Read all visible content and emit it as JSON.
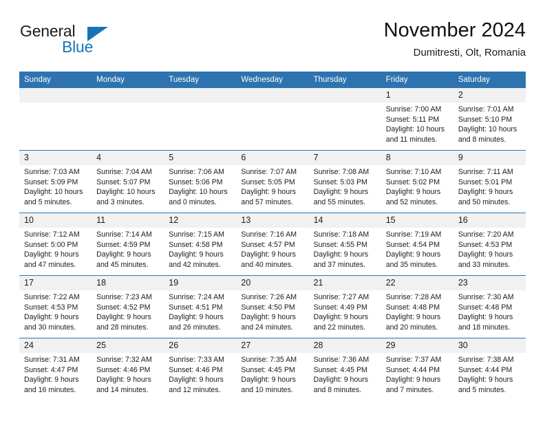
{
  "brand": {
    "name_part1": "General",
    "name_part2": "Blue"
  },
  "header": {
    "title": "November 2024",
    "subtitle": "Dumitresti, Olt, Romania"
  },
  "colors": {
    "header_blue": "#2e73b0",
    "brand_blue": "#1773b8",
    "daynum_bg": "#f1f1f1",
    "text": "#1b1b1b"
  },
  "weekday_headers": [
    "Sunday",
    "Monday",
    "Tuesday",
    "Wednesday",
    "Thursday",
    "Friday",
    "Saturday"
  ],
  "weeks": [
    [
      {
        "day": "",
        "sunrise": "",
        "sunset": "",
        "daylight1": "",
        "daylight2": ""
      },
      {
        "day": "",
        "sunrise": "",
        "sunset": "",
        "daylight1": "",
        "daylight2": ""
      },
      {
        "day": "",
        "sunrise": "",
        "sunset": "",
        "daylight1": "",
        "daylight2": ""
      },
      {
        "day": "",
        "sunrise": "",
        "sunset": "",
        "daylight1": "",
        "daylight2": ""
      },
      {
        "day": "",
        "sunrise": "",
        "sunset": "",
        "daylight1": "",
        "daylight2": ""
      },
      {
        "day": "1",
        "sunrise": "Sunrise: 7:00 AM",
        "sunset": "Sunset: 5:11 PM",
        "daylight1": "Daylight: 10 hours",
        "daylight2": "and 11 minutes."
      },
      {
        "day": "2",
        "sunrise": "Sunrise: 7:01 AM",
        "sunset": "Sunset: 5:10 PM",
        "daylight1": "Daylight: 10 hours",
        "daylight2": "and 8 minutes."
      }
    ],
    [
      {
        "day": "3",
        "sunrise": "Sunrise: 7:03 AM",
        "sunset": "Sunset: 5:09 PM",
        "daylight1": "Daylight: 10 hours",
        "daylight2": "and 5 minutes."
      },
      {
        "day": "4",
        "sunrise": "Sunrise: 7:04 AM",
        "sunset": "Sunset: 5:07 PM",
        "daylight1": "Daylight: 10 hours",
        "daylight2": "and 3 minutes."
      },
      {
        "day": "5",
        "sunrise": "Sunrise: 7:06 AM",
        "sunset": "Sunset: 5:06 PM",
        "daylight1": "Daylight: 10 hours",
        "daylight2": "and 0 minutes."
      },
      {
        "day": "6",
        "sunrise": "Sunrise: 7:07 AM",
        "sunset": "Sunset: 5:05 PM",
        "daylight1": "Daylight: 9 hours",
        "daylight2": "and 57 minutes."
      },
      {
        "day": "7",
        "sunrise": "Sunrise: 7:08 AM",
        "sunset": "Sunset: 5:03 PM",
        "daylight1": "Daylight: 9 hours",
        "daylight2": "and 55 minutes."
      },
      {
        "day": "8",
        "sunrise": "Sunrise: 7:10 AM",
        "sunset": "Sunset: 5:02 PM",
        "daylight1": "Daylight: 9 hours",
        "daylight2": "and 52 minutes."
      },
      {
        "day": "9",
        "sunrise": "Sunrise: 7:11 AM",
        "sunset": "Sunset: 5:01 PM",
        "daylight1": "Daylight: 9 hours",
        "daylight2": "and 50 minutes."
      }
    ],
    [
      {
        "day": "10",
        "sunrise": "Sunrise: 7:12 AM",
        "sunset": "Sunset: 5:00 PM",
        "daylight1": "Daylight: 9 hours",
        "daylight2": "and 47 minutes."
      },
      {
        "day": "11",
        "sunrise": "Sunrise: 7:14 AM",
        "sunset": "Sunset: 4:59 PM",
        "daylight1": "Daylight: 9 hours",
        "daylight2": "and 45 minutes."
      },
      {
        "day": "12",
        "sunrise": "Sunrise: 7:15 AM",
        "sunset": "Sunset: 4:58 PM",
        "daylight1": "Daylight: 9 hours",
        "daylight2": "and 42 minutes."
      },
      {
        "day": "13",
        "sunrise": "Sunrise: 7:16 AM",
        "sunset": "Sunset: 4:57 PM",
        "daylight1": "Daylight: 9 hours",
        "daylight2": "and 40 minutes."
      },
      {
        "day": "14",
        "sunrise": "Sunrise: 7:18 AM",
        "sunset": "Sunset: 4:55 PM",
        "daylight1": "Daylight: 9 hours",
        "daylight2": "and 37 minutes."
      },
      {
        "day": "15",
        "sunrise": "Sunrise: 7:19 AM",
        "sunset": "Sunset: 4:54 PM",
        "daylight1": "Daylight: 9 hours",
        "daylight2": "and 35 minutes."
      },
      {
        "day": "16",
        "sunrise": "Sunrise: 7:20 AM",
        "sunset": "Sunset: 4:53 PM",
        "daylight1": "Daylight: 9 hours",
        "daylight2": "and 33 minutes."
      }
    ],
    [
      {
        "day": "17",
        "sunrise": "Sunrise: 7:22 AM",
        "sunset": "Sunset: 4:53 PM",
        "daylight1": "Daylight: 9 hours",
        "daylight2": "and 30 minutes."
      },
      {
        "day": "18",
        "sunrise": "Sunrise: 7:23 AM",
        "sunset": "Sunset: 4:52 PM",
        "daylight1": "Daylight: 9 hours",
        "daylight2": "and 28 minutes."
      },
      {
        "day": "19",
        "sunrise": "Sunrise: 7:24 AM",
        "sunset": "Sunset: 4:51 PM",
        "daylight1": "Daylight: 9 hours",
        "daylight2": "and 26 minutes."
      },
      {
        "day": "20",
        "sunrise": "Sunrise: 7:26 AM",
        "sunset": "Sunset: 4:50 PM",
        "daylight1": "Daylight: 9 hours",
        "daylight2": "and 24 minutes."
      },
      {
        "day": "21",
        "sunrise": "Sunrise: 7:27 AM",
        "sunset": "Sunset: 4:49 PM",
        "daylight1": "Daylight: 9 hours",
        "daylight2": "and 22 minutes."
      },
      {
        "day": "22",
        "sunrise": "Sunrise: 7:28 AM",
        "sunset": "Sunset: 4:48 PM",
        "daylight1": "Daylight: 9 hours",
        "daylight2": "and 20 minutes."
      },
      {
        "day": "23",
        "sunrise": "Sunrise: 7:30 AM",
        "sunset": "Sunset: 4:48 PM",
        "daylight1": "Daylight: 9 hours",
        "daylight2": "and 18 minutes."
      }
    ],
    [
      {
        "day": "24",
        "sunrise": "Sunrise: 7:31 AM",
        "sunset": "Sunset: 4:47 PM",
        "daylight1": "Daylight: 9 hours",
        "daylight2": "and 16 minutes."
      },
      {
        "day": "25",
        "sunrise": "Sunrise: 7:32 AM",
        "sunset": "Sunset: 4:46 PM",
        "daylight1": "Daylight: 9 hours",
        "daylight2": "and 14 minutes."
      },
      {
        "day": "26",
        "sunrise": "Sunrise: 7:33 AM",
        "sunset": "Sunset: 4:46 PM",
        "daylight1": "Daylight: 9 hours",
        "daylight2": "and 12 minutes."
      },
      {
        "day": "27",
        "sunrise": "Sunrise: 7:35 AM",
        "sunset": "Sunset: 4:45 PM",
        "daylight1": "Daylight: 9 hours",
        "daylight2": "and 10 minutes."
      },
      {
        "day": "28",
        "sunrise": "Sunrise: 7:36 AM",
        "sunset": "Sunset: 4:45 PM",
        "daylight1": "Daylight: 9 hours",
        "daylight2": "and 8 minutes."
      },
      {
        "day": "29",
        "sunrise": "Sunrise: 7:37 AM",
        "sunset": "Sunset: 4:44 PM",
        "daylight1": "Daylight: 9 hours",
        "daylight2": "and 7 minutes."
      },
      {
        "day": "30",
        "sunrise": "Sunrise: 7:38 AM",
        "sunset": "Sunset: 4:44 PM",
        "daylight1": "Daylight: 9 hours",
        "daylight2": "and 5 minutes."
      }
    ]
  ]
}
